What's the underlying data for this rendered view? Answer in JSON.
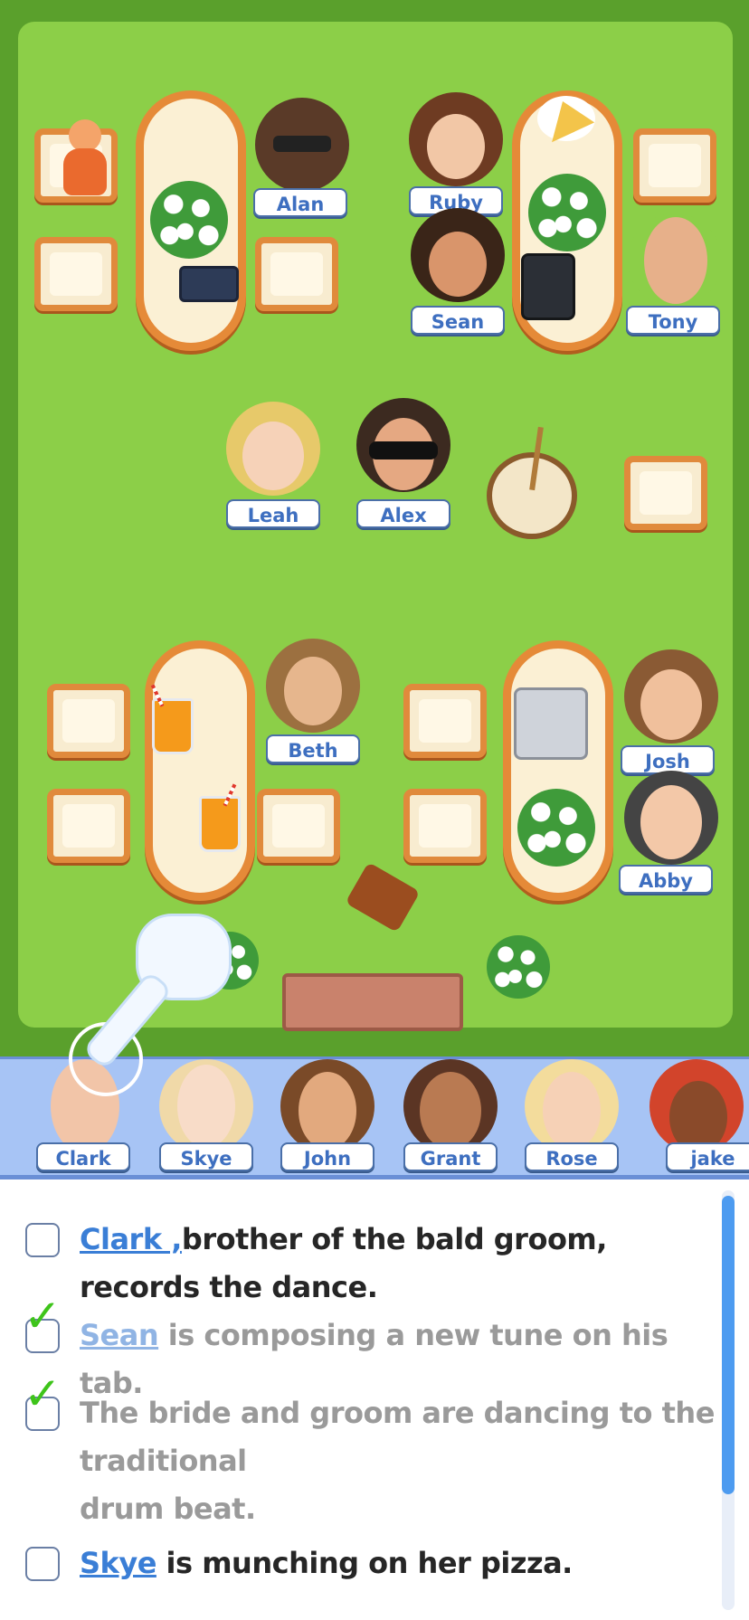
{
  "board": {
    "seated": [
      {
        "name": "Alan"
      },
      {
        "name": "Ruby"
      },
      {
        "name": "Sean"
      },
      {
        "name": "Tony"
      },
      {
        "name": "Leah"
      },
      {
        "name": "Alex"
      },
      {
        "name": "Beth"
      },
      {
        "name": "Josh"
      },
      {
        "name": "Abby"
      }
    ]
  },
  "tray": {
    "characters": [
      {
        "name": "Clark"
      },
      {
        "name": "Skye"
      },
      {
        "name": "John"
      },
      {
        "name": "Grant"
      },
      {
        "name": "Rose"
      },
      {
        "name": "jake"
      }
    ]
  },
  "clues": [
    {
      "name": "Clark ,",
      "text": "brother of the bald groom, records the dance.",
      "done": false
    },
    {
      "name": "Sean",
      "text": " is composing a new tune on his tab.",
      "done": true
    },
    {
      "name": "",
      "text": "The bride and groom are dancing to the traditional",
      "text2": "drum beat.",
      "done": true
    },
    {
      "name": "Skye",
      "text": " is munching on her pizza.",
      "done": false
    }
  ],
  "colors": {
    "board_green": "#8ccf48",
    "outer_green": "#5aa02c",
    "tray_blue": "#a7c4f5",
    "name_blue": "#3e6fc0",
    "check_green": "#3ec41a"
  }
}
